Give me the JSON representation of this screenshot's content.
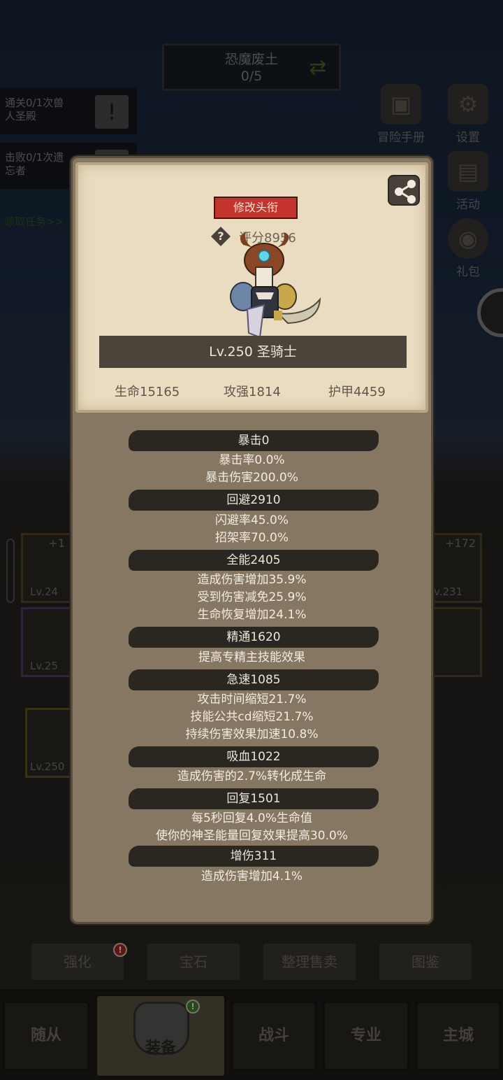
{
  "zone": {
    "name": "恐魔废土",
    "progress": "0/5",
    "icon": "refresh-icon"
  },
  "quests": [
    {
      "text_line1": "通关0/1次兽",
      "text_line2": "人圣殿"
    },
    {
      "text_line1": "击败0/1次遗",
      "text_line2": "忘者"
    }
  ],
  "quest_link": "领取任务>>",
  "side_menu": [
    {
      "label": "冒险手册",
      "icon": "book-icon"
    },
    {
      "label": "设置",
      "icon": "gear-icon"
    },
    {
      "label": "活动",
      "icon": "calendar-icon"
    },
    {
      "label": "礼包",
      "icon": "gift-icon"
    }
  ],
  "gear_slots": {
    "left_top_plus": "+1",
    "left_top_lv": "Lv.24",
    "left_mid_lv": "Lv.25",
    "right_top_plus": "+172",
    "right_top_lv": "v.231",
    "weapon_lv": "Lv.250"
  },
  "card": {
    "title_button": "修改头衔",
    "score": "评分8956",
    "level_class": "Lv.250 圣骑士",
    "stats": {
      "hp": "生命15165",
      "attack": "攻强1814",
      "armor": "护甲4459"
    }
  },
  "attributes": [
    {
      "header": "暴击0",
      "lines": [
        "暴击率0.0%",
        "暴击伤害200.0%"
      ]
    },
    {
      "header": "回避2910",
      "lines": [
        "闪避率45.0%",
        "招架率70.0%"
      ]
    },
    {
      "header": "全能2405",
      "lines": [
        "造成伤害增加35.9%",
        "受到伤害减免25.9%",
        "生命恢复增加24.1%"
      ]
    },
    {
      "header": "精通1620",
      "lines": [
        "提高专精主技能效果"
      ]
    },
    {
      "header": "急速1085",
      "lines": [
        "攻击时间缩短21.7%",
        "技能公共cd缩短21.7%",
        "持续伤害效果加速10.8%"
      ]
    },
    {
      "header": "吸血1022",
      "lines": [
        "造成伤害的2.7%转化成生命"
      ]
    },
    {
      "header": "回复1501",
      "lines": [
        "每5秒回复4.0%生命值",
        "使你的神圣能量回复效果提高30.0%"
      ]
    },
    {
      "header": "增伤311",
      "lines": [
        "造成伤害增加4.1%"
      ]
    }
  ],
  "actions": [
    "强化",
    "宝石",
    "整理售卖",
    "图鉴"
  ],
  "nav": [
    "随从",
    "装备",
    "战斗",
    "专业",
    "主城"
  ],
  "colors": {
    "accent_red": "#c5342c",
    "parchment": "#e9dcc0",
    "panel": "#857762"
  }
}
